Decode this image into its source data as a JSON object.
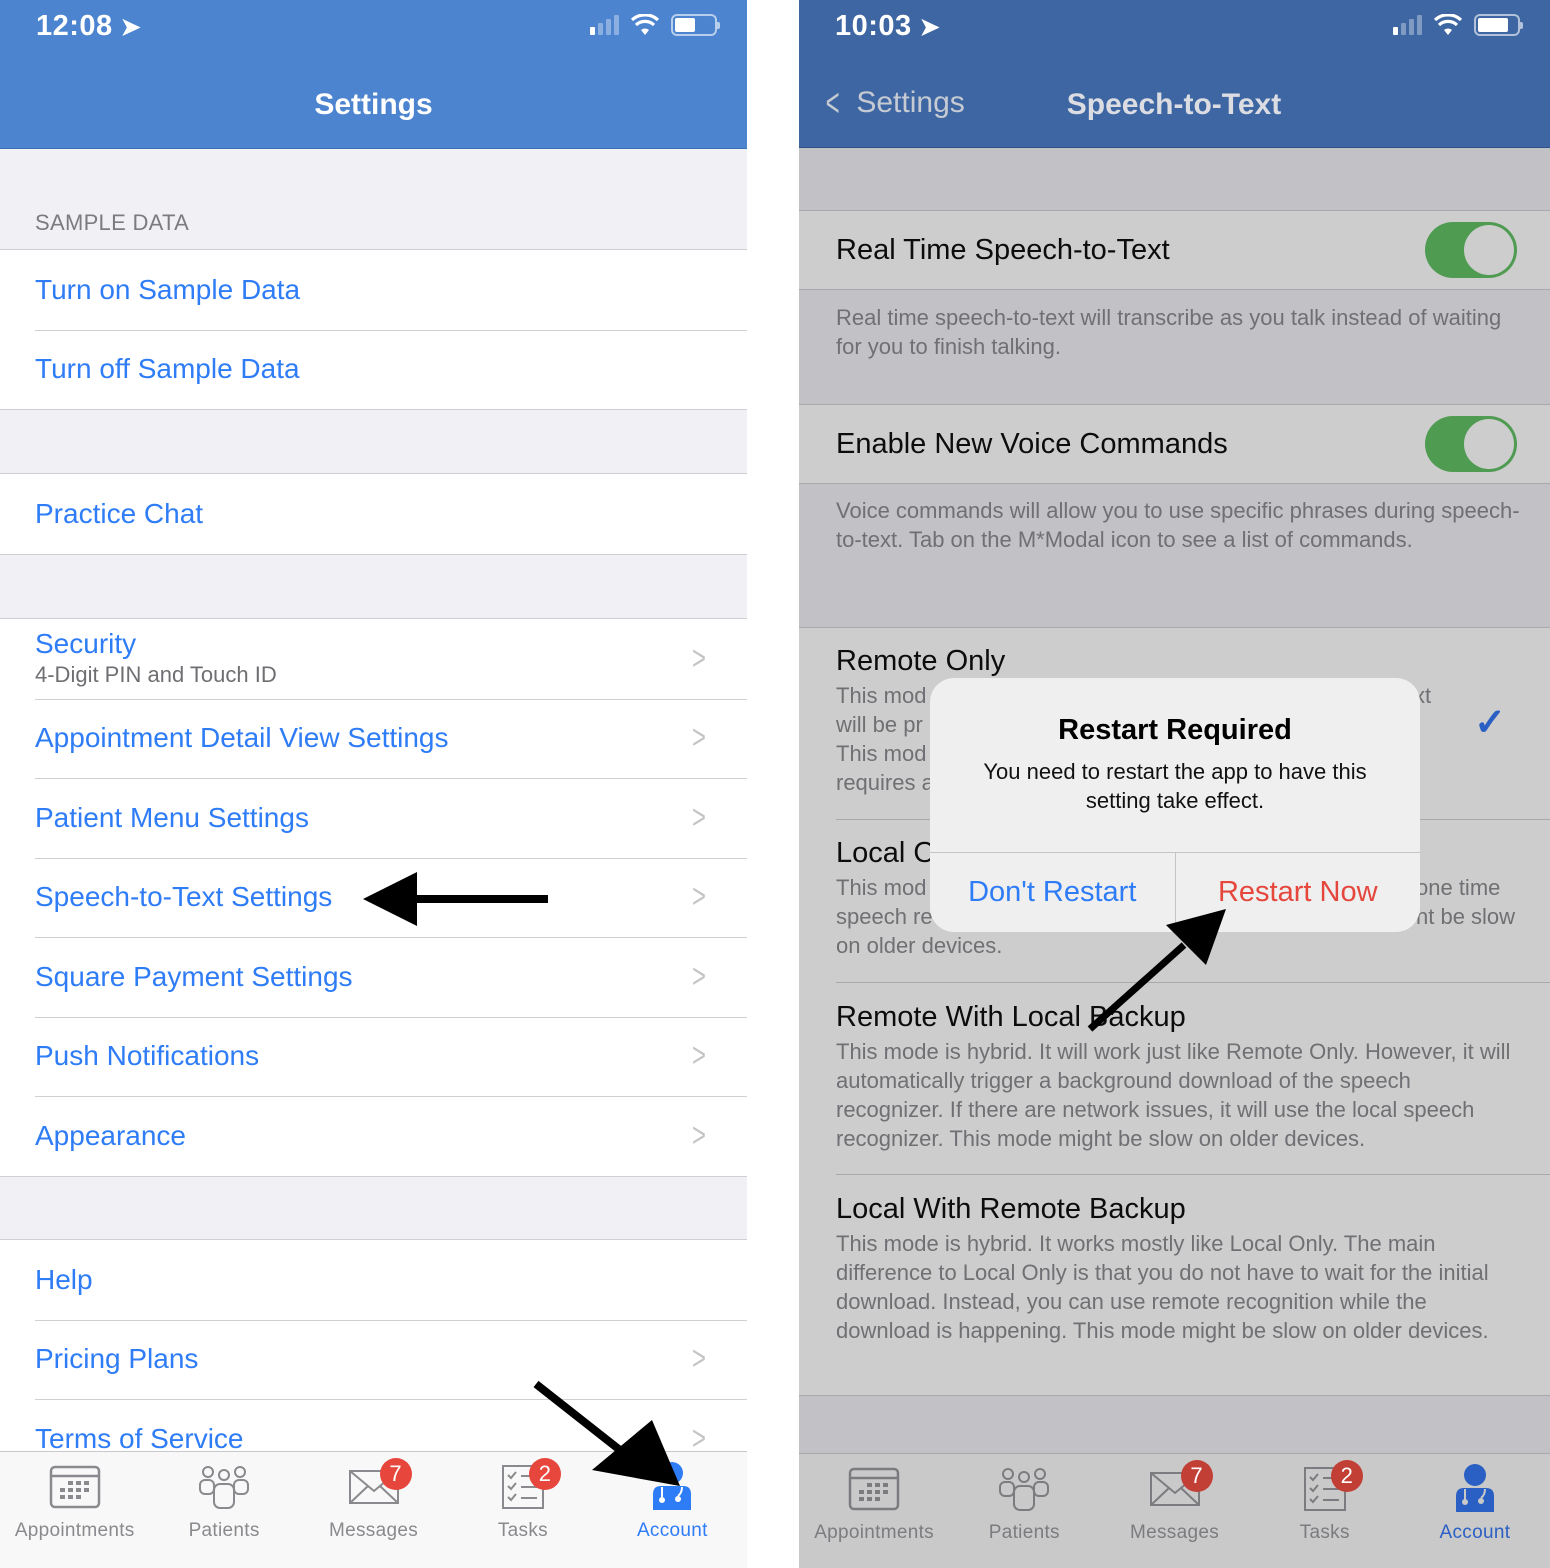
{
  "left_screen": {
    "status": {
      "time": "12:08",
      "signal_bars_active": 1,
      "battery_level": 0.5
    },
    "nav_title": "Settings",
    "sections": [
      {
        "header": "SAMPLE DATA",
        "items": [
          {
            "label": "Turn on Sample Data",
            "chevron": false
          },
          {
            "label": "Turn off Sample Data",
            "chevron": false
          }
        ]
      },
      {
        "header": "",
        "items": [
          {
            "label": "Practice Chat",
            "chevron": false
          }
        ]
      },
      {
        "header": "",
        "items": [
          {
            "label": "Security",
            "subtitle": "4-Digit PIN and Touch ID",
            "chevron": true
          },
          {
            "label": "Appointment Detail View Settings",
            "chevron": true
          },
          {
            "label": "Patient Menu Settings",
            "chevron": true
          },
          {
            "label": "Speech-to-Text Settings",
            "chevron": true
          },
          {
            "label": "Square Payment Settings",
            "chevron": true
          },
          {
            "label": "Push Notifications",
            "chevron": true
          },
          {
            "label": "Appearance",
            "chevron": true
          }
        ]
      },
      {
        "header": "",
        "items": [
          {
            "label": "Help",
            "chevron": false
          },
          {
            "label": "Pricing Plans",
            "chevron": true
          },
          {
            "label": "Terms of Service",
            "chevron": true
          }
        ]
      }
    ],
    "tabbar": [
      {
        "label": "Appointments",
        "icon": "calendar-icon",
        "badge": null,
        "active": false
      },
      {
        "label": "Patients",
        "icon": "people-icon",
        "badge": null,
        "active": false
      },
      {
        "label": "Messages",
        "icon": "envelope-icon",
        "badge": "7",
        "active": false
      },
      {
        "label": "Tasks",
        "icon": "checklist-icon",
        "badge": "2",
        "active": false
      },
      {
        "label": "Account",
        "icon": "doctor-icon",
        "badge": null,
        "active": true
      }
    ]
  },
  "right_screen": {
    "status": {
      "time": "10:03",
      "signal_bars_active": 1,
      "battery_level": 0.8
    },
    "nav_back_label": "Settings",
    "nav_title": "Speech-to-Text",
    "toggles": [
      {
        "label": "Real Time Speech-to-Text",
        "on": true,
        "footer": "Real time speech-to-text will transcribe as you talk instead of waiting for you to finish talking."
      },
      {
        "label": "Enable New Voice Commands",
        "on": true,
        "footer": "Voice commands will allow you to use specific phrases during speech-to-text. Tab on the M*Modal icon to see a list of commands."
      }
    ],
    "modes": [
      {
        "title": "Remote Only",
        "selected": true,
        "visible_description_fragments": [
          "This mod",
          "will be pr",
          "This mod",
          "requires a",
          "xt"
        ]
      },
      {
        "title": "Local O",
        "selected": false,
        "visible_description_fragments": [
          "This mod",
          "speech re",
          "on older devices.",
          "one time",
          "nt be slow"
        ]
      },
      {
        "title": "Remote With Local Backup",
        "selected": false,
        "description": "This mode is hybrid. It will work just like Remote Only. However, it will automatically trigger a background download of the speech recognizer. If there are network issues, it will use the local speech recognizer. This mode might be slow on older devices."
      },
      {
        "title": "Local With Remote Backup",
        "selected": false,
        "description": "This mode is hybrid. It works mostly like Local Only. The main difference to Local Only is that you do not have to wait for the initial download. Instead, you can use remote recognition while the download is happening. This mode might be slow on older devices."
      }
    ],
    "alert": {
      "title": "Restart Required",
      "message": "You need to restart the app to have this setting take effect.",
      "cancel_label": "Don't Restart",
      "confirm_label": "Restart Now"
    },
    "tabbar": [
      {
        "label": "Appointments",
        "icon": "calendar-icon",
        "badge": null,
        "active": false
      },
      {
        "label": "Patients",
        "icon": "people-icon",
        "badge": null,
        "active": false
      },
      {
        "label": "Messages",
        "icon": "envelope-icon",
        "badge": "7",
        "active": false
      },
      {
        "label": "Tasks",
        "icon": "checklist-icon",
        "badge": "2",
        "active": false
      },
      {
        "label": "Account",
        "icon": "doctor-icon",
        "badge": null,
        "active": true
      }
    ]
  },
  "colors": {
    "left_navbar": "#4d84cf",
    "right_navbar_dimmed": "#3d66a2",
    "link_blue": "#2e7cf6",
    "toggle_green": "#4e9b51",
    "destructive_red": "#e5473d",
    "badge_red": "#e6463c"
  },
  "annotations": [
    {
      "type": "arrow",
      "points_to": "Speech-to-Text Settings"
    },
    {
      "type": "arrow",
      "points_to": "Account tab"
    },
    {
      "type": "arrow",
      "points_to": "Restart Now"
    }
  ]
}
